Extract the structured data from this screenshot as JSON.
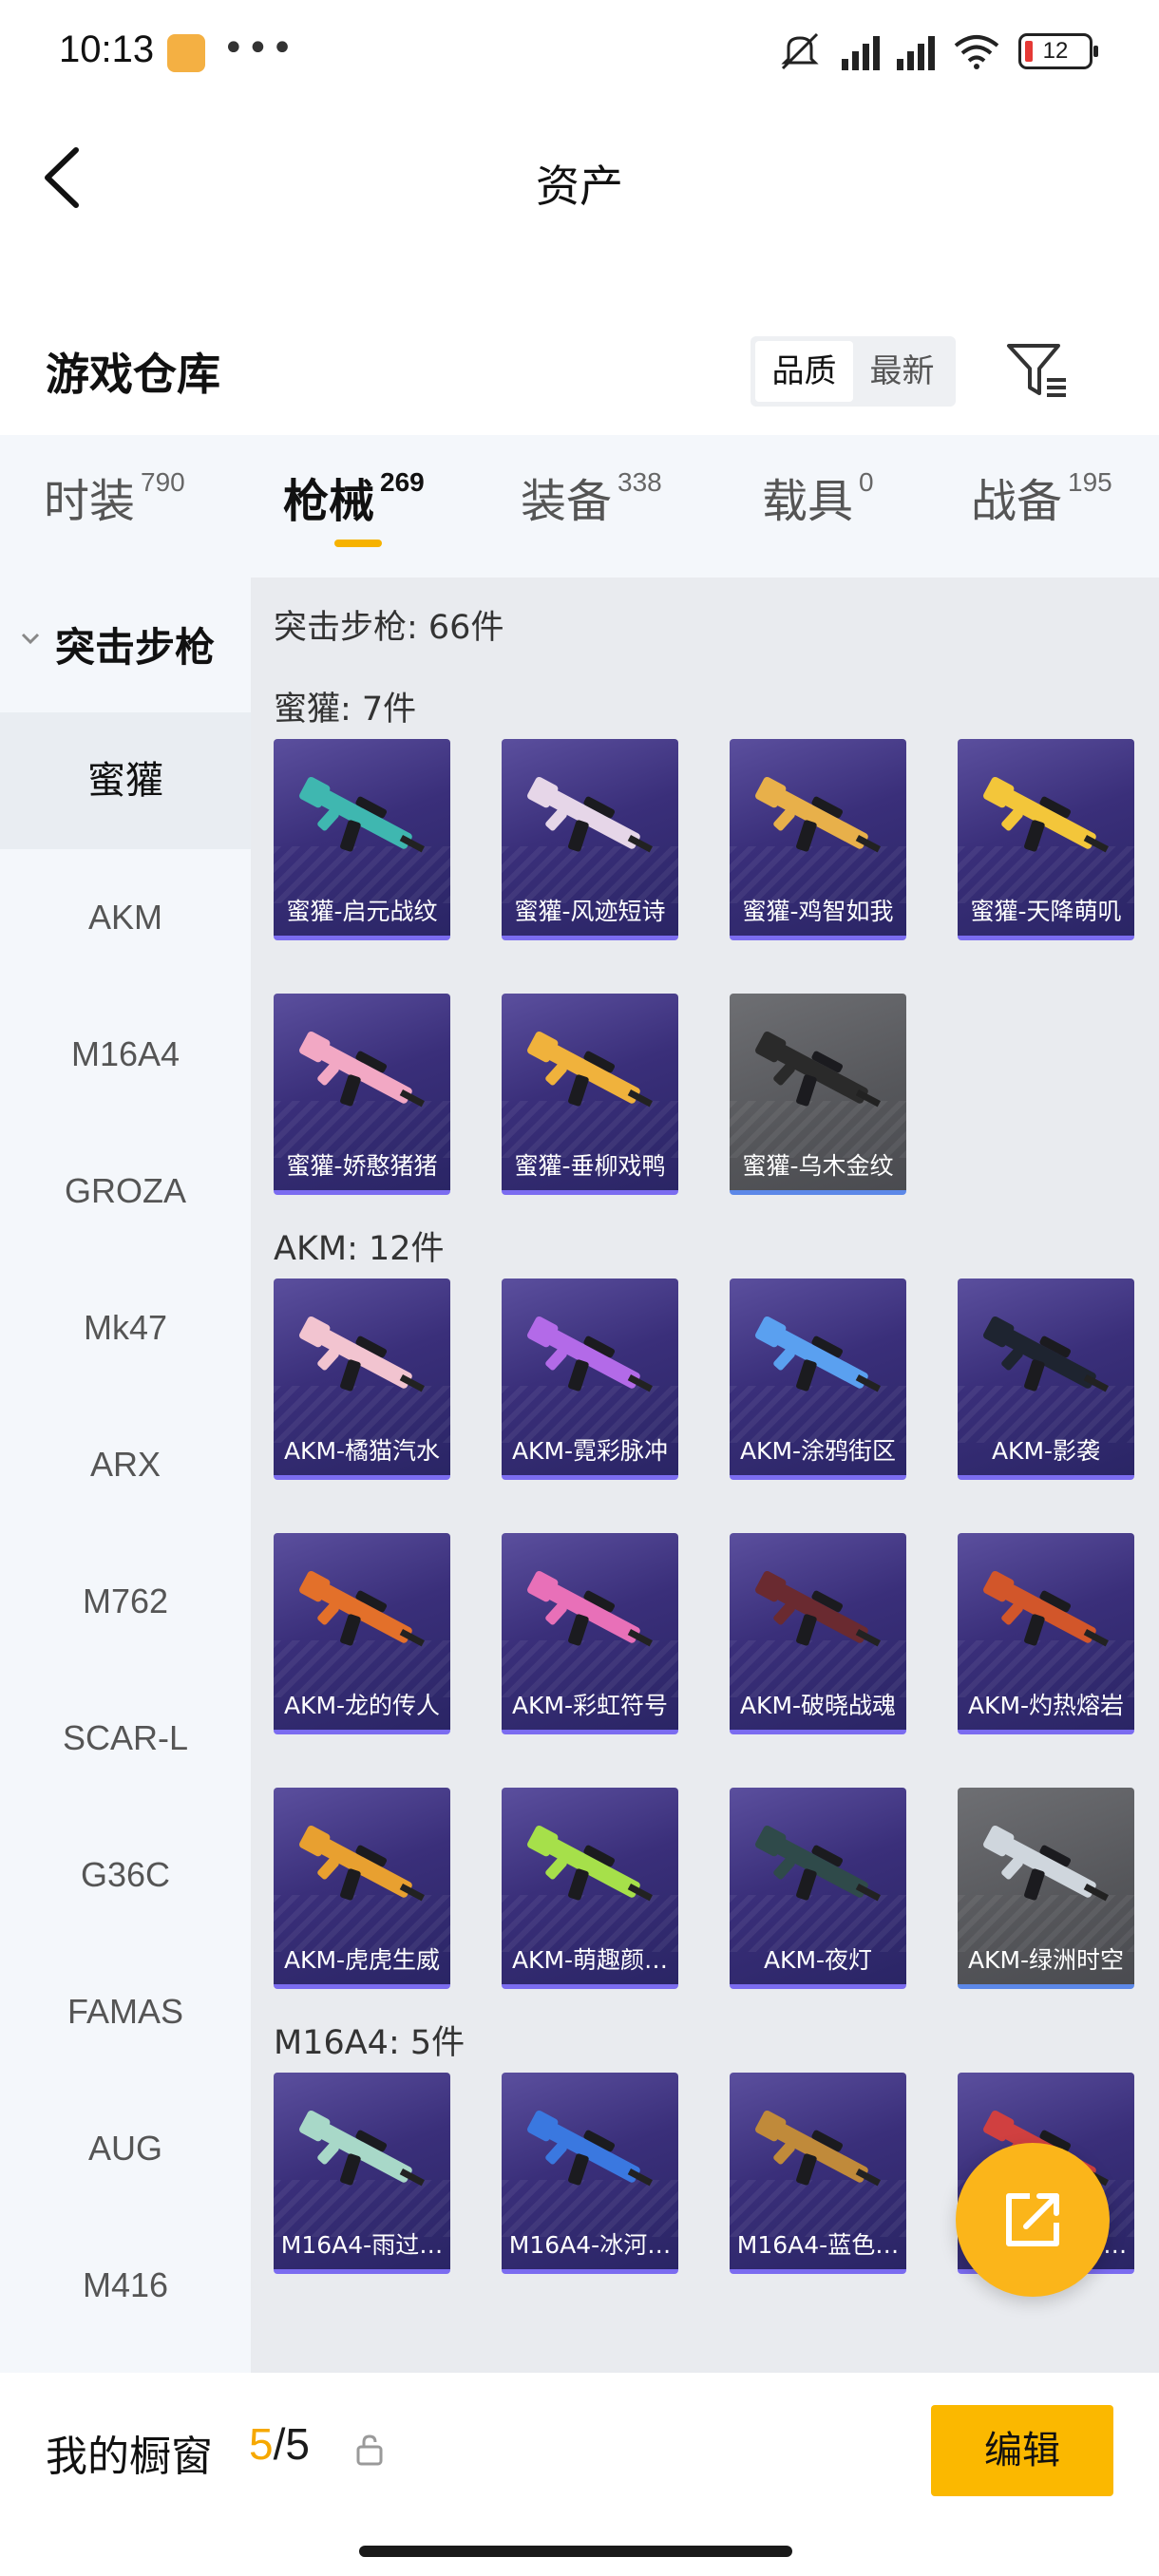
{
  "status_bar": {
    "time": "10:13",
    "dots": "•••",
    "battery": "12"
  },
  "header": {
    "title": "资产"
  },
  "warehouse": {
    "title": "游戏仓库",
    "sort_options": [
      "品质",
      "最新"
    ],
    "active_sort": "品质"
  },
  "category_tabs": [
    {
      "label": "时装",
      "count": "790"
    },
    {
      "label": "枪械",
      "count": "269",
      "active": true
    },
    {
      "label": "装备",
      "count": "338"
    },
    {
      "label": "载具",
      "count": "0"
    },
    {
      "label": "战备",
      "count": "195"
    }
  ],
  "sidebar": {
    "group_label": "突击步枪",
    "items": [
      "蜜獾",
      "AKM",
      "M16A4",
      "GROZA",
      "Mk47",
      "ARX",
      "M762",
      "SCAR-L",
      "G36C",
      "FAMAS",
      "AUG",
      "M416"
    ],
    "active": "蜜獾"
  },
  "main": {
    "group_summary": "突击步枪: 66件",
    "sections": [
      {
        "label": "蜜獾: 7件",
        "items": [
          {
            "name": "蜜獾-启元战纹",
            "color": "#3fb7b0"
          },
          {
            "name": "蜜獾-风迹短诗",
            "color": "#e6d6e8"
          },
          {
            "name": "蜜獾-鸡智如我",
            "color": "#e8b04a"
          },
          {
            "name": "蜜獾-天降萌叽",
            "color": "#f3c63a"
          },
          {
            "name": "蜜獾-娇憨猪猪",
            "color": "#f2a8c4"
          },
          {
            "name": "蜜獾-垂柳戏鸭",
            "color": "#f0b23c"
          },
          {
            "name": "蜜獾-乌木金纹",
            "color": "#2a2a2a",
            "gray": true
          }
        ]
      },
      {
        "label": "AKM: 12件",
        "items": [
          {
            "name": "AKM-橘猫汽水",
            "color": "#f2c4d0"
          },
          {
            "name": "AKM-霓彩脉冲",
            "color": "#b36ae8"
          },
          {
            "name": "AKM-涂鸦街区",
            "color": "#5aa0f0"
          },
          {
            "name": "AKM-影袭",
            "color": "#1e2430"
          },
          {
            "name": "AKM-龙的传人",
            "color": "#e3702a"
          },
          {
            "name": "AKM-彩虹符号",
            "color": "#e870b8"
          },
          {
            "name": "AKM-破晓战魂",
            "color": "#6a2a30"
          },
          {
            "name": "AKM-灼热熔岩",
            "color": "#d2562a"
          },
          {
            "name": "AKM-虎虎生威",
            "color": "#e8a030"
          },
          {
            "name": "AKM-萌趣颜…",
            "color": "#a6e04a"
          },
          {
            "name": "AKM-夜灯",
            "color": "#2f4a4a"
          },
          {
            "name": "AKM-绿洲时空",
            "color": "#cfd6dd",
            "gray": true
          }
        ]
      },
      {
        "label": "M16A4: 5件",
        "items": [
          {
            "name": "M16A4-雨过…",
            "color": "#a8d8c8"
          },
          {
            "name": "M16A4-冰河…",
            "color": "#3a78e0"
          },
          {
            "name": "M16A4-蓝色…",
            "color": "#c08a3a"
          },
          {
            "name": "M16A4-红色…",
            "color": "#d04040"
          }
        ]
      }
    ]
  },
  "bottom": {
    "showcase_label": "我的橱窗",
    "current": "5",
    "total": "/5",
    "edit_label": "编辑"
  },
  "colors": {
    "accent": "#fbb800",
    "card_purple": "#3a2f7a",
    "card_gray": "#55565a"
  }
}
